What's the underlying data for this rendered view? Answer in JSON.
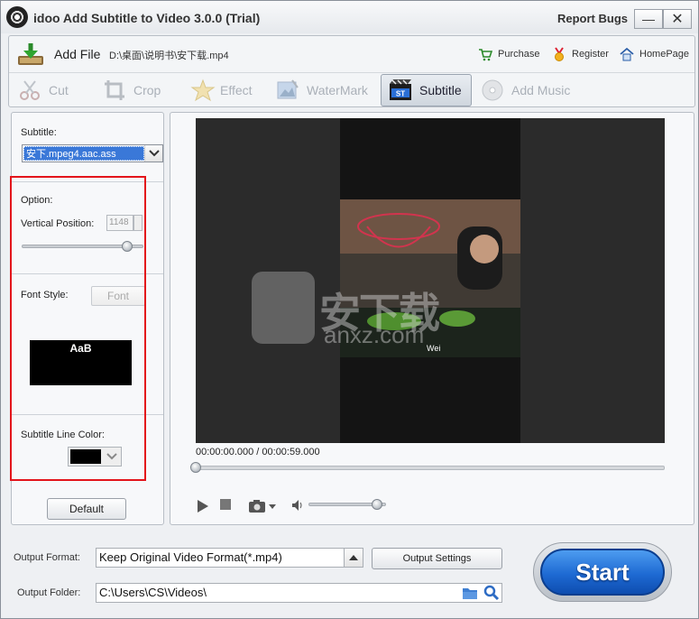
{
  "window": {
    "title": "idoo Add Subtitle to Video 3.0.0 (Trial)",
    "report_bugs": "Report Bugs",
    "minimize": "—",
    "close": "✕"
  },
  "topbar": {
    "add_file": "Add File",
    "file_path": "D:\\桌面\\说明书\\安下载.mp4",
    "purchase": "Purchase",
    "register": "Register",
    "homepage": "HomePage"
  },
  "tabs": [
    {
      "label": "Cut",
      "icon": "scissors-icon",
      "active": false
    },
    {
      "label": "Crop",
      "icon": "crop-icon",
      "active": false
    },
    {
      "label": "Effect",
      "icon": "star-icon",
      "active": false
    },
    {
      "label": "WaterMark",
      "icon": "watermark-icon",
      "active": false
    },
    {
      "label": "Subtitle",
      "icon": "subtitle-icon",
      "active": true
    },
    {
      "label": "Add Music",
      "icon": "disc-icon",
      "active": false
    }
  ],
  "left": {
    "subtitle_label": "Subtitle:",
    "subtitle_value": "安下.mpeg4.aac.ass",
    "option_label": "Option:",
    "vpos_label": "Vertical Position:",
    "vpos_value": "1148",
    "vpos_slider_fraction": 0.9,
    "font_style_label": "Font Style:",
    "font_button": "Font",
    "font_preview": "AaB",
    "line_color_label": "Subtitle Line Color:",
    "line_color": "#000000",
    "default_button": "Default"
  },
  "player": {
    "timecode": "00:00:00.000 / 00:00:59.000",
    "seek_fraction": 0.0,
    "volume_fraction": 0.95,
    "subtitle_text": "Wei",
    "watermark_text": "安下载",
    "watermark_sub": "anxz.com"
  },
  "output": {
    "format_label": "Output Format:",
    "format_value": "Keep Original Video Format(*.mp4)",
    "settings_button": "Output Settings",
    "folder_label": "Output Folder:",
    "folder_value": "C:\\Users\\CS\\Videos\\",
    "start_button": "Start"
  },
  "colors": {
    "accent": "#1e6ad3",
    "highlight_red": "#e3141b",
    "selection": "#3a78d8"
  }
}
